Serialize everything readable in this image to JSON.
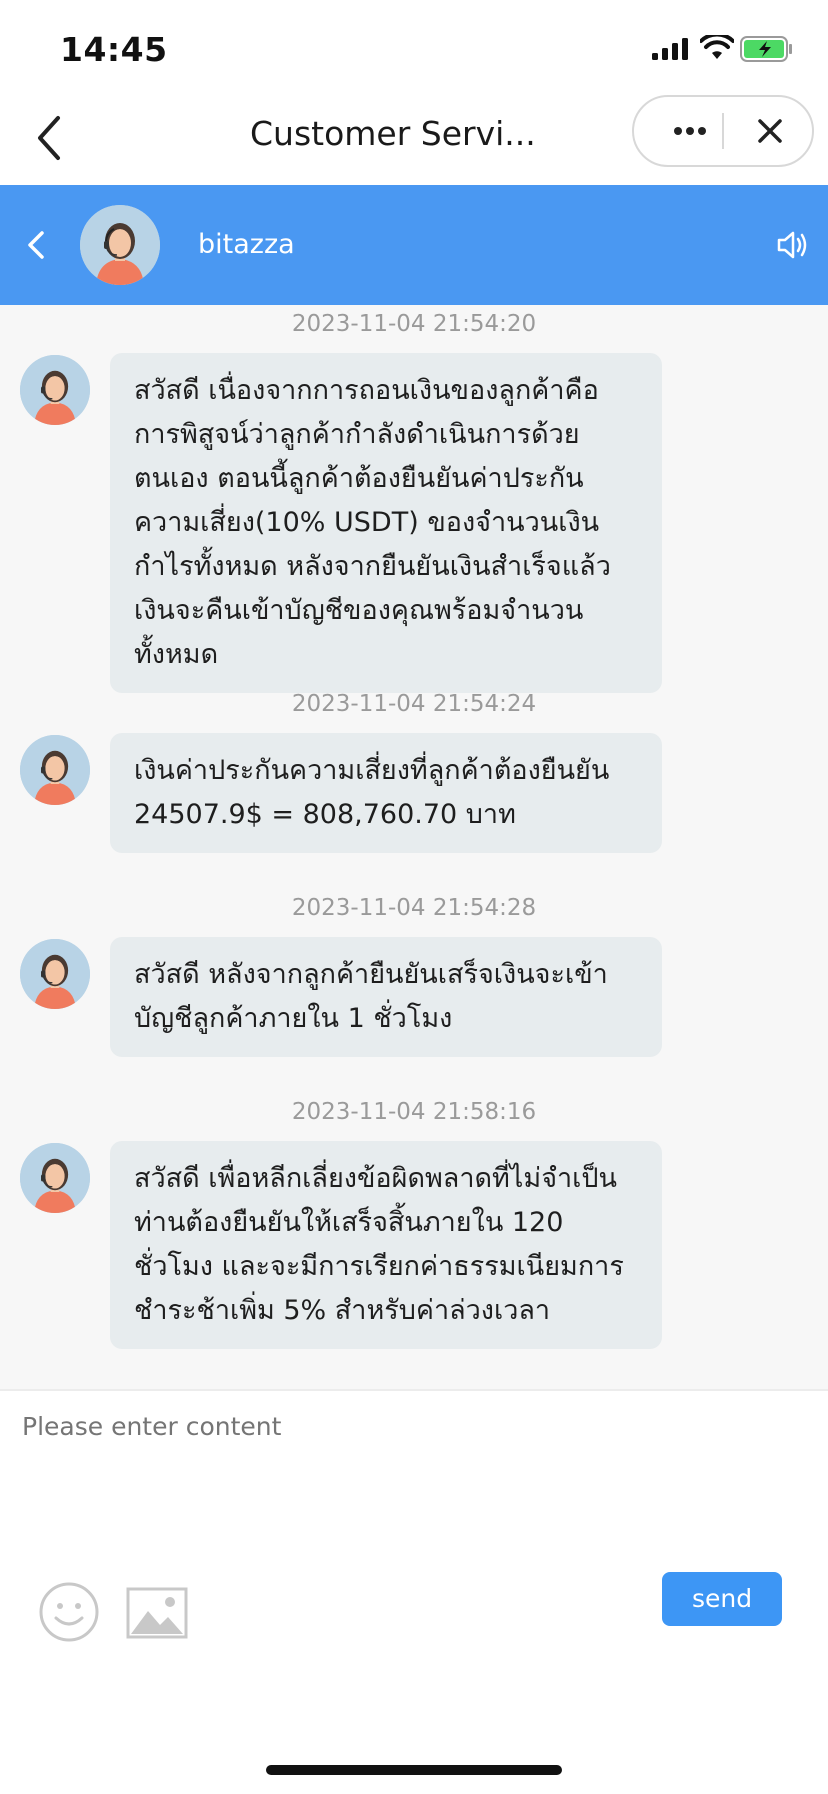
{
  "status_bar": {
    "time": "14:45"
  },
  "nav": {
    "title": "Customer Servi..."
  },
  "chat_header": {
    "name": "bitazza"
  },
  "messages": [
    {
      "timestamp": "2023-11-04 21:54:20",
      "text": "สวัสดี เนื่องจากการถอนเงินของลูกค้าคือการพิสูจน์ว่าลูกค้ากำลังดำเนินการด้วยตนเอง ตอนนี้ลูกค้าต้องยืนยันค่าประกันความเสี่ยง(10% USDT) ของจำนวนเงินกำไรทั้งหมด หลังจากยืนยันเงินสำเร็จแล้วเงินจะคืนเข้าบัญชีของคุณพร้อมจำนวนทั้งหมด"
    },
    {
      "timestamp": "2023-11-04 21:54:24",
      "text": "เงินค่าประกันความเสี่ยงที่ลูกค้าต้องยืนยัน 24507.9$ = 808,760.70 บาท"
    },
    {
      "timestamp": "2023-11-04 21:54:28",
      "text": "สวัสดี หลังจากลูกค้ายืนยันเสร็จเงินจะเข้าบัญชีลูกค้าภายใน 1 ชั่วโมง"
    },
    {
      "timestamp": "2023-11-04 21:58:16",
      "text": "สวัสดี เพื่อหลีกเลี่ยงข้อผิดพลาดที่ไม่จำเป็น ท่านต้องยืนยันให้เสร็จสิ้นภายใน 120 ชั่วโมง และจะมีการเรียกค่าธรรมเนียมการชำระช้าเพิ่ม 5% สำหรับค่าล่วงเวลา"
    }
  ],
  "input": {
    "placeholder": "Please enter content"
  },
  "send_label": "send",
  "icons": {
    "nav_back": "chevron-left-icon",
    "more": "more-dots-icon",
    "close": "close-icon",
    "speaker": "speaker-icon",
    "emoji": "smiley-icon",
    "image": "image-icon"
  },
  "colors": {
    "header": "#4a98f2",
    "send_button": "#3d96f5",
    "bubble": "#e7ecee"
  }
}
